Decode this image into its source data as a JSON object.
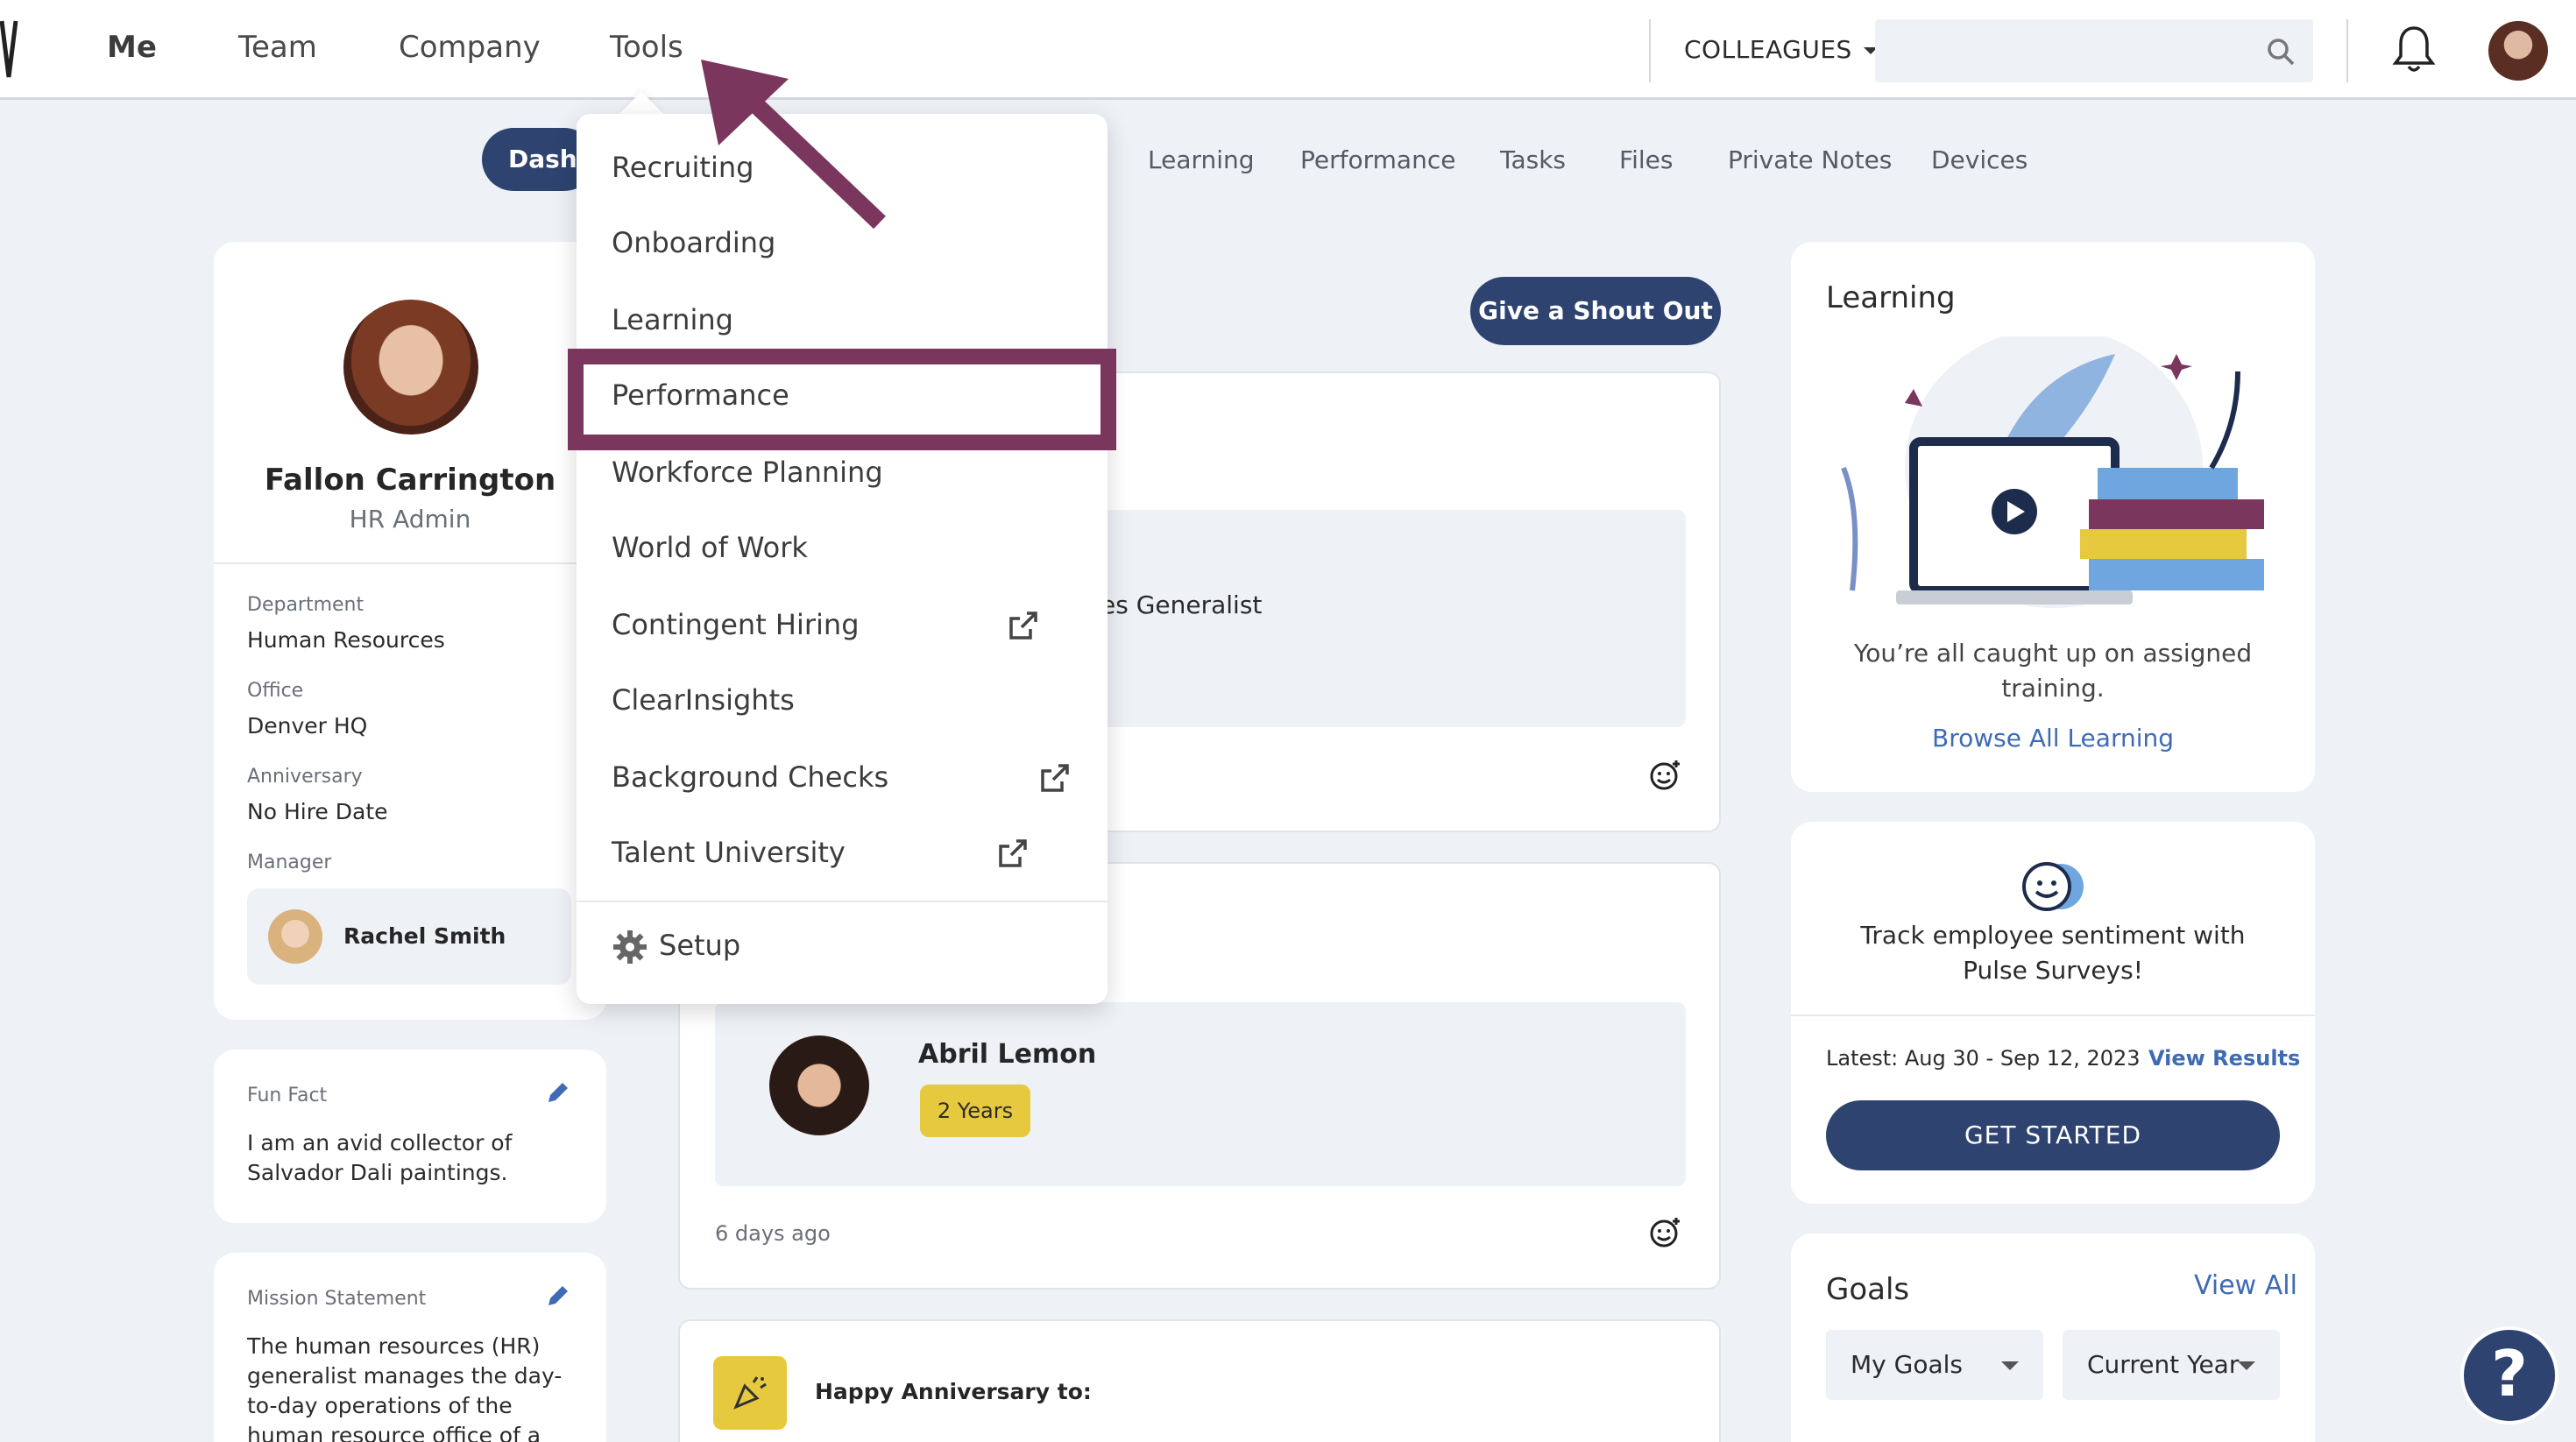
{
  "topnav": {
    "links": [
      "Me",
      "Team",
      "Company",
      "Tools"
    ],
    "colleagues_label": "COLLEAGUES",
    "search_placeholder": ""
  },
  "subtabs": {
    "active": "Dashb",
    "items": [
      "Learning",
      "Performance",
      "Tasks",
      "Files",
      "Private Notes",
      "Devices"
    ]
  },
  "profile": {
    "name": "Fallon Carrington",
    "role": "HR Admin",
    "fields": [
      {
        "label": "Department",
        "value": "Human Resources"
      },
      {
        "label": "Office",
        "value": "Denver HQ"
      },
      {
        "label": "Anniversary",
        "value": "No Hire Date"
      },
      {
        "label": "Manager",
        "value": "Rachel Smith"
      }
    ]
  },
  "fun_fact": {
    "label": "Fun Fact",
    "text": "I am an avid collector of Salvador Dali paintings."
  },
  "mission": {
    "label": "Mission Statement",
    "text": "The human resources (HR) generalist manages the day-to-day operations of the human resource office of a company, as"
  },
  "feed": {
    "shout_out_button": "Give a Shout Out",
    "post1_fragment": "es Generalist",
    "anniversary_person": "Abril Lemon",
    "anniversary_badge": "2 Years",
    "anniversary_time": "6 days ago",
    "happy_anniversary": "Happy Anniversary to:"
  },
  "learning_card": {
    "title": "Learning",
    "message": "You’re all caught up on assigned training.",
    "link": "Browse All Learning"
  },
  "pulse_card": {
    "message": "Track employee sentiment with Pulse Surveys!",
    "latest": "Latest: Aug 30 - Sep 12, 2023",
    "view_results": "View Results",
    "button": "GET STARTED"
  },
  "goals_card": {
    "title": "Goals",
    "view_all": "View All",
    "filter1": "My Goals",
    "filter2": "Current Year"
  },
  "tools_menu": {
    "items": [
      {
        "label": "Recruiting",
        "external": false
      },
      {
        "label": "Onboarding",
        "external": false
      },
      {
        "label": "Learning",
        "external": false
      },
      {
        "label": "Performance",
        "external": false
      },
      {
        "label": "Workforce Planning",
        "external": false
      },
      {
        "label": "World of Work",
        "external": false
      },
      {
        "label": "Contingent Hiring",
        "external": true
      },
      {
        "label": "ClearInsights",
        "external": false
      },
      {
        "label": "Background Checks",
        "external": true
      },
      {
        "label": "Talent University",
        "external": true
      }
    ],
    "setup": "Setup"
  },
  "help_label": "?",
  "colors": {
    "navy": "#2e4370",
    "highlight": "#7b365e",
    "badge_yellow": "#e6c93f",
    "link_blue": "#3e6bb3"
  }
}
